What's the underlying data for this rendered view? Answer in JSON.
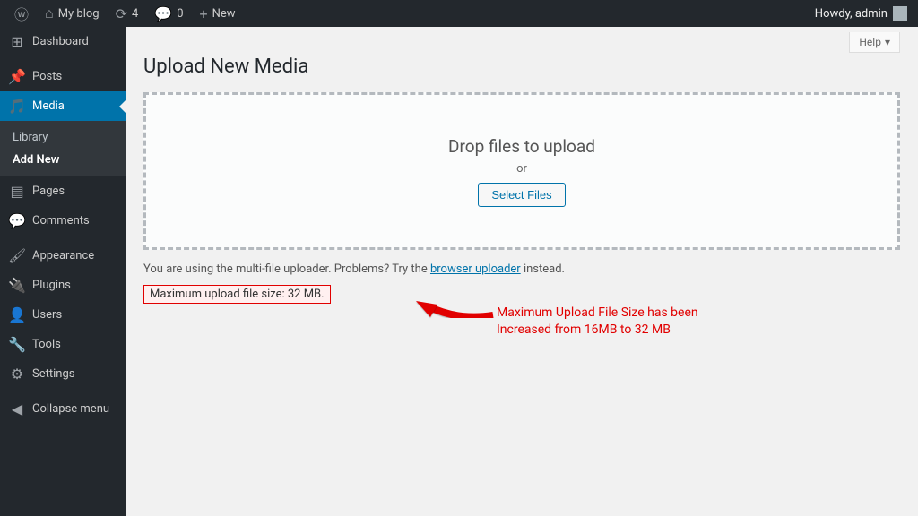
{
  "adminbar": {
    "site_name": "My blog",
    "updates_count": "4",
    "comments_count": "0",
    "new_label": "New",
    "howdy_prefix": "Howdy, ",
    "user_name": "admin"
  },
  "sidebar": {
    "dashboard": "Dashboard",
    "posts": "Posts",
    "media": "Media",
    "media_sub": {
      "library": "Library",
      "add_new": "Add New"
    },
    "pages": "Pages",
    "comments": "Comments",
    "appearance": "Appearance",
    "plugins": "Plugins",
    "users": "Users",
    "tools": "Tools",
    "settings": "Settings",
    "collapse": "Collapse menu"
  },
  "main": {
    "help_label": "Help",
    "title": "Upload New Media",
    "drop_text": "Drop files to upload",
    "or": "or",
    "select_files": "Select Files",
    "helper_pre": "You are using the multi-file uploader. Problems? Try the ",
    "helper_link": "browser uploader",
    "helper_post": " instead.",
    "max_size": "Maximum upload file size: 32 MB."
  },
  "annotation": {
    "line1": "Maximum Upload File Size has been",
    "line2": "Increased from 16MB to 32 MB"
  }
}
